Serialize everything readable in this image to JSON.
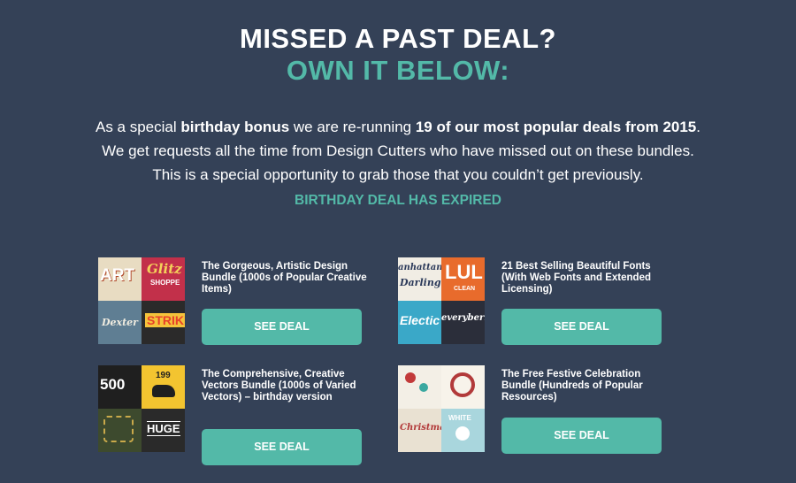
{
  "header": {
    "line1": "MISSED A PAST DEAL?",
    "line2": "OWN IT BELOW:"
  },
  "intro": {
    "p1_a": "As a special ",
    "p1_b": "birthday bonus",
    "p1_c": " we are re-running ",
    "p1_d": "19 of our most popular deals from 2015",
    "p1_e": ".",
    "p2": "We get requests all the time from Design Cutters who have missed out on these bundles.",
    "p3": "This is a special opportunity to grab those that you couldn’t get previously."
  },
  "status": "BIRTHDAY DEAL HAS EXPIRED",
  "deals": [
    {
      "title": "The Gorgeous, Artistic Design Bundle (1000s of Popular Creative Items)",
      "button": "SEE DEAL",
      "thumb_text": [
        "ART",
        "Glitz",
        "SHOPPE",
        "Dexter",
        "STRIKE"
      ]
    },
    {
      "title": "21 Best Selling Beautiful Fonts (With Web Fonts and Extended Licensing)",
      "button": "SEE DEAL",
      "thumb_text": [
        "anhattan",
        "Darling",
        "LUL",
        "CLEAN",
        "Electic",
        "everyberry"
      ]
    },
    {
      "title": "The Comprehensive, Creative Vectors Bundle (1000s of Varied Vectors) – birthday version",
      "button": "SEE DEAL",
      "thumb_text": [
        "500",
        "199",
        "HUGE"
      ]
    },
    {
      "title": "The Free Festive Celebration Bundle (Hundreds of Popular Resources)",
      "button": "SEE DEAL",
      "thumb_text": [
        "Christmas",
        "WHITE"
      ]
    }
  ],
  "colors": {
    "background": "#344157",
    "accent": "#53b9a8",
    "text": "#ffffff"
  }
}
